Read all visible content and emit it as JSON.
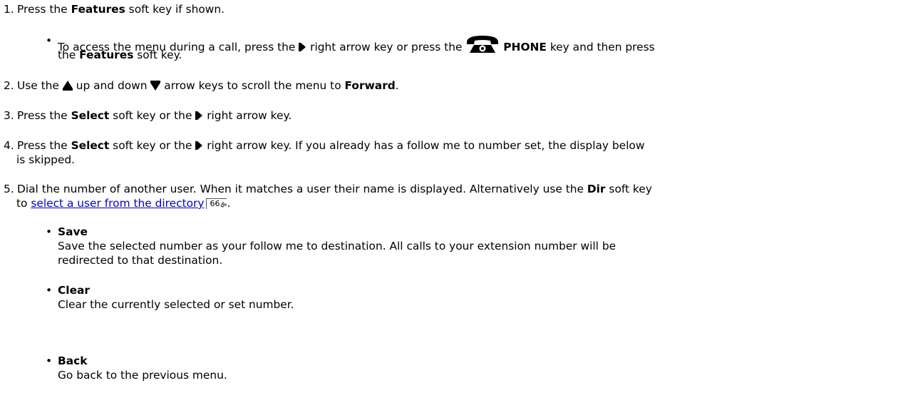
{
  "steps": [
    {
      "number": "1.",
      "segments": [
        "Press the ",
        "Features",
        " soft key if shown."
      ],
      "sub_bullet": {
        "line1": [
          "To access the menu during a call, press the ",
          " right arrow key or press the ",
          " ",
          "PHONE",
          " key and then press"
        ],
        "line2": [
          "the ",
          "Features",
          " soft key."
        ]
      }
    },
    {
      "number": "2.",
      "segments": [
        "Use the ",
        " up and down ",
        " arrow keys to scroll the menu to ",
        "Forward",
        "."
      ]
    },
    {
      "number": "3.",
      "segments": [
        "Press the ",
        "Select",
        " soft key or the ",
        " right arrow key."
      ]
    },
    {
      "number": "4.",
      "line1": [
        "Press the ",
        "Select",
        " soft key or the ",
        " right arrow key. If you already has a follow me to number set, the display below"
      ],
      "line2": "is skipped."
    },
    {
      "number": "5.",
      "line1": [
        "Dial the number of another user. When it matches a user their name is displayed. Alternatively use the ",
        "Dir",
        " soft key"
      ],
      "line2": [
        "to ",
        "select a user from the directory",
        "66",
        "."
      ]
    }
  ],
  "options": [
    {
      "title": "Save",
      "line1": "Save the selected number as your follow me to destination. All calls to your extension number will be",
      "line2": "redirected to that destination."
    },
    {
      "title": "Clear",
      "line1": "Clear the currently selected or set number."
    },
    {
      "title": "Back",
      "line1": "Go back to the previous menu."
    }
  ],
  "bullet": "•",
  "icons": {
    "right_arrow": "right-arrow-key-icon",
    "up_arrow": "up-arrow-key-icon",
    "down_arrow": "down-arrow-key-icon",
    "phone": "phone-key-icon",
    "page_ref": "page-reference-arrow-icon"
  },
  "colors": {
    "link": "#0000cc",
    "text": "#000000"
  }
}
